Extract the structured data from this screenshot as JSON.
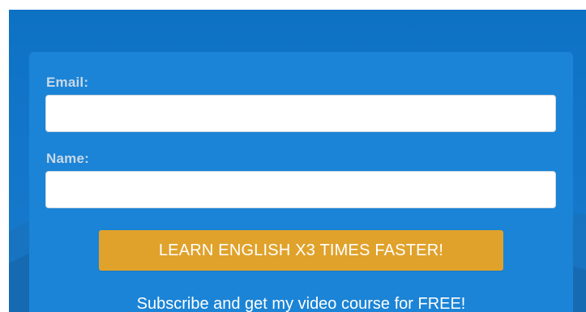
{
  "form": {
    "email_label": "Email:",
    "email_value": "",
    "name_label": "Name:",
    "name_value": "",
    "submit_label": "LEARN ENGLISH X3 TIMES FASTER!",
    "subscribe_text": "Subscribe and get my video course for FREE!"
  },
  "colors": {
    "background_blue": "#1577c9",
    "card_blue": "#1b84d6",
    "button_orange": "#e0a22b",
    "label_color": "#c9d8e8"
  }
}
